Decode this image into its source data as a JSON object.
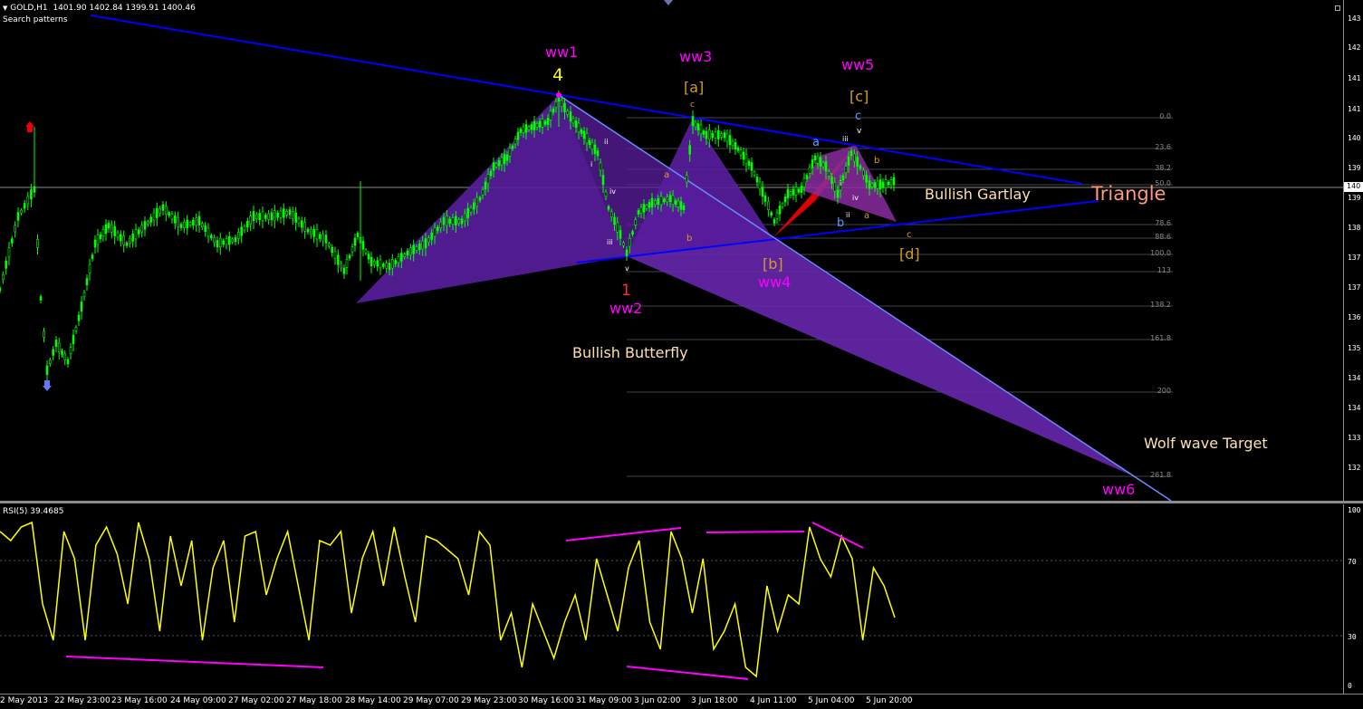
{
  "header": {
    "symbol": "GOLD,H1",
    "ohlc": "1401.90 1402.84 1399.91 1400.46",
    "indicator_name": "Search patterns"
  },
  "rsi_header": {
    "label": "RSI(5) 39.4685"
  },
  "price_axis": [
    "143",
    "142",
    "141",
    "141",
    "140",
    "139",
    "139",
    "138",
    "137",
    "137",
    "136",
    "135",
    "134",
    "134",
    "133",
    "132"
  ],
  "current_price_tag": "140",
  "rsi_axis": [
    "100",
    "70",
    "30",
    "0"
  ],
  "time_axis": [
    "2 May 2013",
    "22 May 23:00",
    "23 May 16:00",
    "24 May 09:00",
    "27 May 02:00",
    "27 May 18:00",
    "28 May 14:00",
    "29 May 07:00",
    "29 May 23:00",
    "30 May 16:00",
    "31 May 09:00",
    "3 Jun 02:00",
    "3 Jun 18:00",
    "4 Jun 11:00",
    "5 Jun 04:00",
    "5 Jun 20:00"
  ],
  "fib_levels": [
    "0.0",
    "23.6",
    "38.2",
    "50.0",
    "78.6",
    "88.6",
    "100.0",
    "113",
    "138.2",
    "161.8",
    "200",
    "261.8"
  ],
  "annotations": {
    "ww1": "ww1",
    "ww2": "ww2",
    "ww3": "ww3",
    "ww4": "ww4",
    "ww5": "ww5",
    "ww6": "ww6",
    "wave4": "4",
    "wave1": "1",
    "a_bracket": "[a]",
    "b_bracket": "[b]",
    "c_bracket": "[c]",
    "d_bracket": "[d]",
    "bullish_butterfly": "Bullish Butterfly",
    "bullish_gartlay": "Bullish Gartlay",
    "triangle": "Triangle",
    "wolf_wave_target": "Wolf wave Target"
  },
  "colors": {
    "candles": "#00ff00",
    "pattern_fill": "#5a1ea0",
    "trendline": "#0000ff",
    "rsi_line": "#ffff00",
    "divergence": "#ff00ff",
    "wolf_line": "#6a8cff"
  }
}
